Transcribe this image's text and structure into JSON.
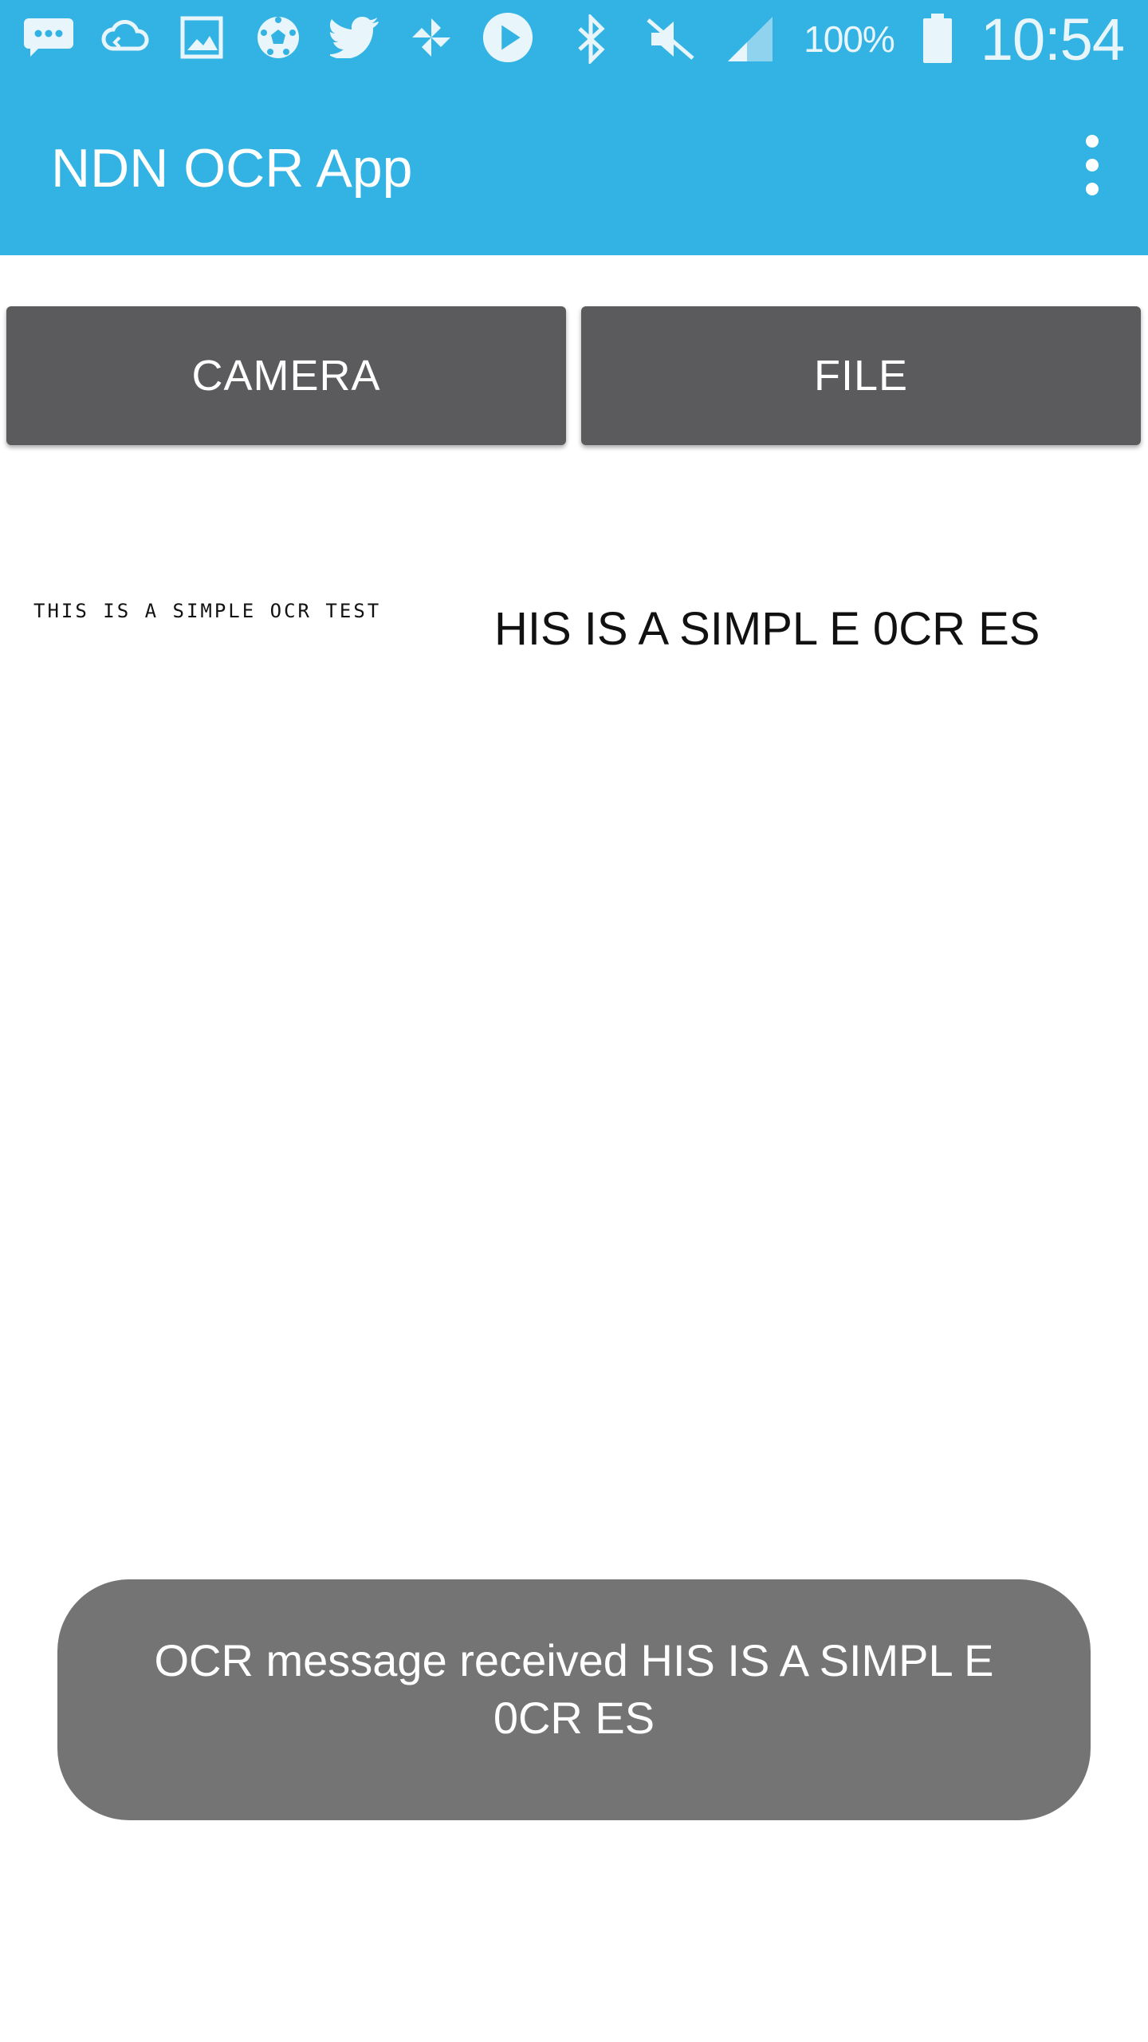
{
  "status_bar": {
    "icons_left": [
      "chat-bubble-icon",
      "cloud-sync-icon",
      "image-icon",
      "soccer-ball-icon",
      "twitter-bird-icon",
      "pinwheel-icon",
      "play-circle-icon"
    ],
    "icons_right": [
      "bluetooth-icon",
      "mute-icon",
      "signal-icon",
      "battery-icon"
    ],
    "battery": "100%",
    "time": "10:54"
  },
  "app_bar": {
    "title": "NDN OCR App",
    "overflow_icon": "more-vert-icon"
  },
  "buttons": {
    "camera": "CAMERA",
    "file": "FILE"
  },
  "content": {
    "source_image_text": "THIS IS A SIMPLE OCR TEST",
    "ocr_result": "HIS IS A SIMPL E 0CR ES"
  },
  "toast": {
    "message": "OCR message received HIS IS A SIMPL E 0CR ES"
  },
  "colors": {
    "primary": "#33b3e3",
    "button": "#5b5b5d",
    "toast": "#747474"
  }
}
